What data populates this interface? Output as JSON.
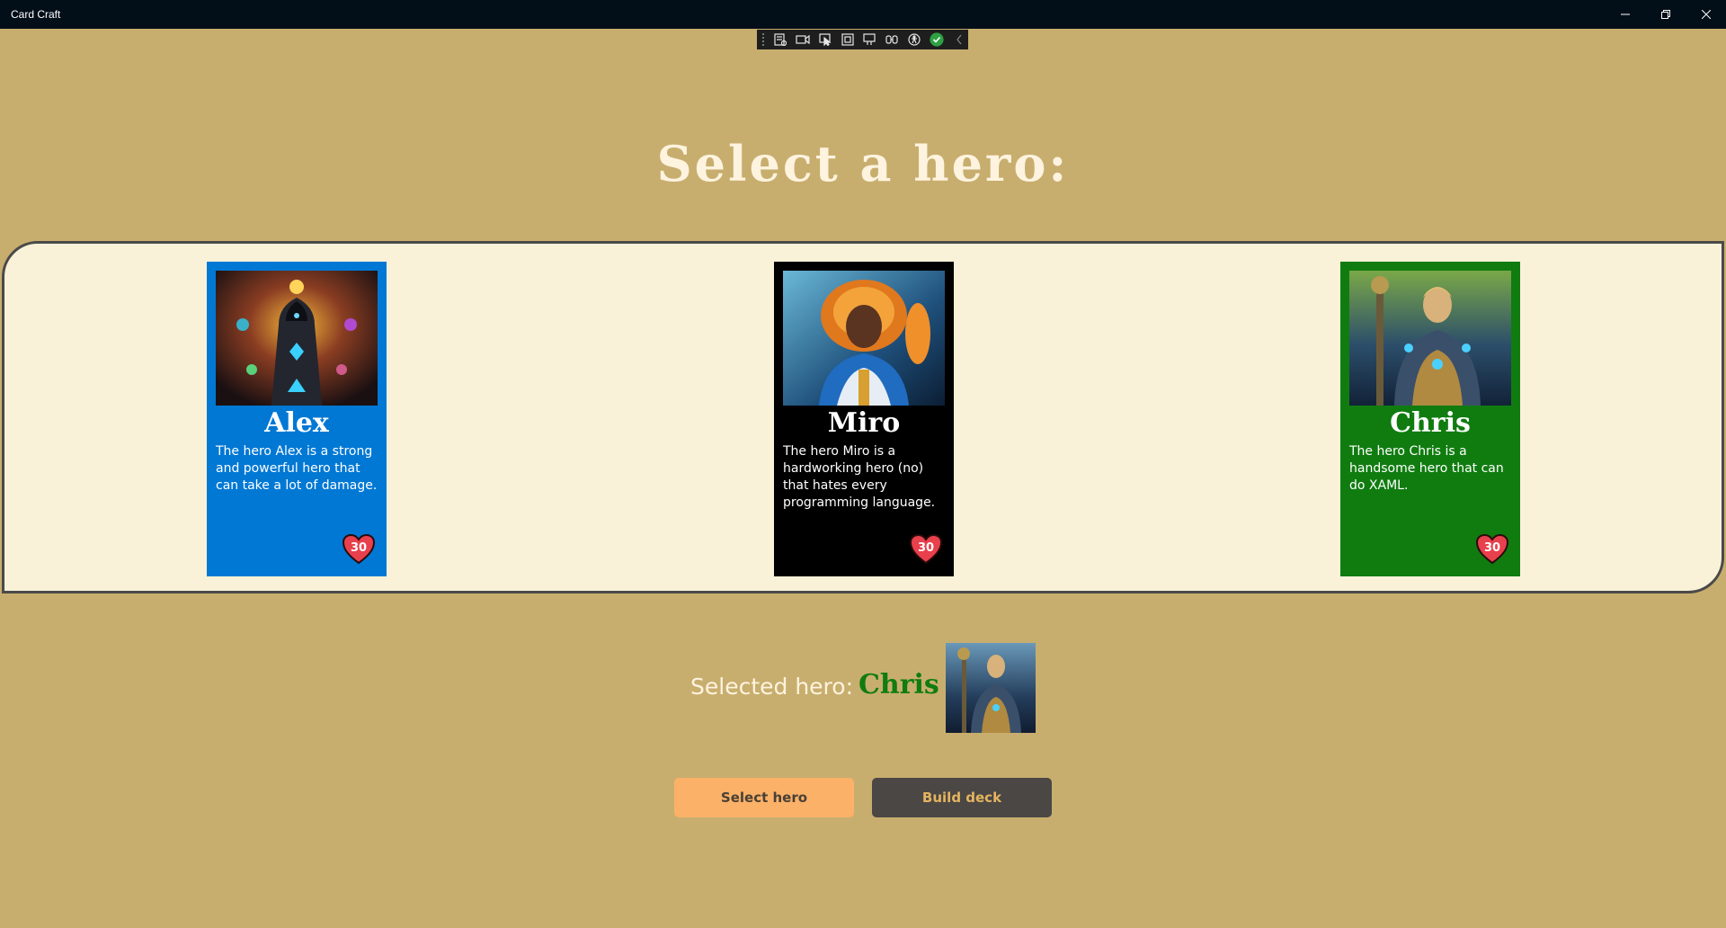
{
  "window": {
    "title": "Card Craft",
    "controls": [
      "minimize",
      "maximize",
      "close"
    ]
  },
  "dev_toolbar": {
    "icons": [
      "live-visual-tree-icon",
      "record-icon",
      "select-element-icon",
      "display-layout-adorners-icon",
      "track-focus-icon",
      "binding-failures-icon",
      "accessibility-icon",
      "checkmark-icon",
      "collapse-chevron-icon"
    ]
  },
  "heading": "Select a hero:",
  "heroes": [
    {
      "name": "Alex",
      "description": "The hero Alex is a strong and powerful hero that can take a lot of damage.",
      "health": "30",
      "color": "#0078d4",
      "portrait_theme": "hooded mage with glowing runes"
    },
    {
      "name": "Miro",
      "description": "The hero Miro is a hardworking hero (no) that hates every programming language.",
      "health": "30",
      "color": "#000000",
      "portrait_theme": "fiery-haired warrior in blue armor"
    },
    {
      "name": "Chris",
      "description": "The hero Chris is a handsome hero that can do XAML.",
      "health": "30",
      "color": "#107c10",
      "portrait_theme": "armored knight with staff"
    }
  ],
  "selection": {
    "label": "Selected hero:",
    "hero_name": "Chris",
    "hero_color": "#107c10"
  },
  "buttons": {
    "select": "Select hero",
    "build": "Build deck"
  },
  "colors": {
    "background": "#c8ae6e",
    "panel": "#faf2d8",
    "heart": "#e8404c"
  }
}
